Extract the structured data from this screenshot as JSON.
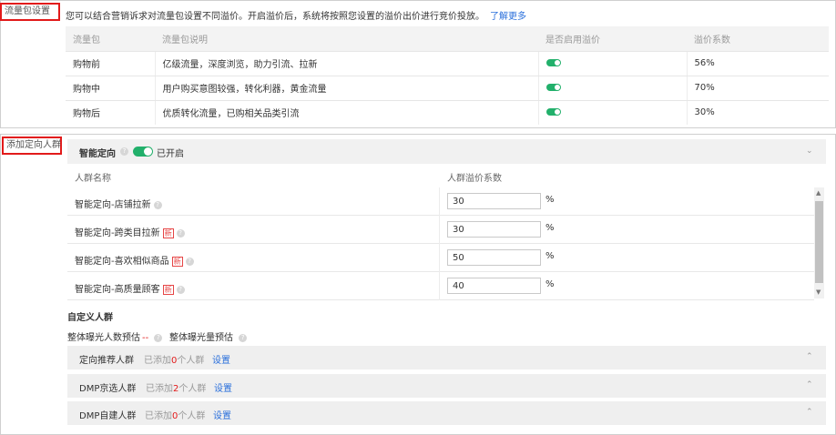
{
  "traffic_packages": {
    "section_label": "流量包设置",
    "intro_text": "您可以结合营销诉求对流量包设置不同溢价。开启溢价后，系统将按照您设置的溢价出价进行竞价投放。",
    "learn_more": "了解更多",
    "columns": [
      "流量包",
      "流量包说明",
      "是否启用溢价",
      "溢价系数"
    ],
    "rows": [
      {
        "name": "购物前",
        "desc": "亿级流量，深度浏览，助力引流、拉新",
        "enabled": true,
        "coef": "56%"
      },
      {
        "name": "购物中",
        "desc": "用户购买意图较强，转化利器，黄金流量",
        "enabled": true,
        "coef": "70%"
      },
      {
        "name": "购物后",
        "desc": "优质转化流量，已购相关品类引流",
        "enabled": true,
        "coef": "30%"
      }
    ]
  },
  "targeting": {
    "section_label": "添加定向人群",
    "smart": {
      "title": "智能定向",
      "status": "已开启",
      "enabled": true
    },
    "columns": [
      "人群名称",
      "人群溢价系数"
    ],
    "rows": [
      {
        "name": "智能定向-店铺拉新",
        "is_new": false,
        "new_label": "",
        "value": "30",
        "unit": "%"
      },
      {
        "name": "智能定向-跨类目拉新",
        "is_new": true,
        "new_label": "新",
        "value": "30",
        "unit": "%"
      },
      {
        "name": "智能定向-喜欢相似商品",
        "is_new": true,
        "new_label": "新",
        "value": "50",
        "unit": "%"
      },
      {
        "name": "智能定向-高质量顾客",
        "is_new": true,
        "new_label": "新",
        "value": "40",
        "unit": "%"
      }
    ],
    "custom": {
      "title": "自定义人群",
      "est_people_label": "整体曝光人数预估",
      "est_people_value": "--",
      "est_exposure_label": "整体曝光量预估",
      "groups": [
        {
          "name": "定向推荐人群",
          "prefix": "已添加",
          "count": "0",
          "suffix": "个人群",
          "action": "设置"
        },
        {
          "name": "DMP京选人群",
          "prefix": "已添加",
          "count": "2",
          "suffix": "个人群",
          "action": "设置"
        },
        {
          "name": "DMP自建人群",
          "prefix": "已添加",
          "count": "0",
          "suffix": "个人群",
          "action": "设置"
        }
      ]
    }
  },
  "colors": {
    "accent_green": "#22b06b",
    "highlight_red": "#e21a1a",
    "link_blue": "#2a6fdb"
  }
}
